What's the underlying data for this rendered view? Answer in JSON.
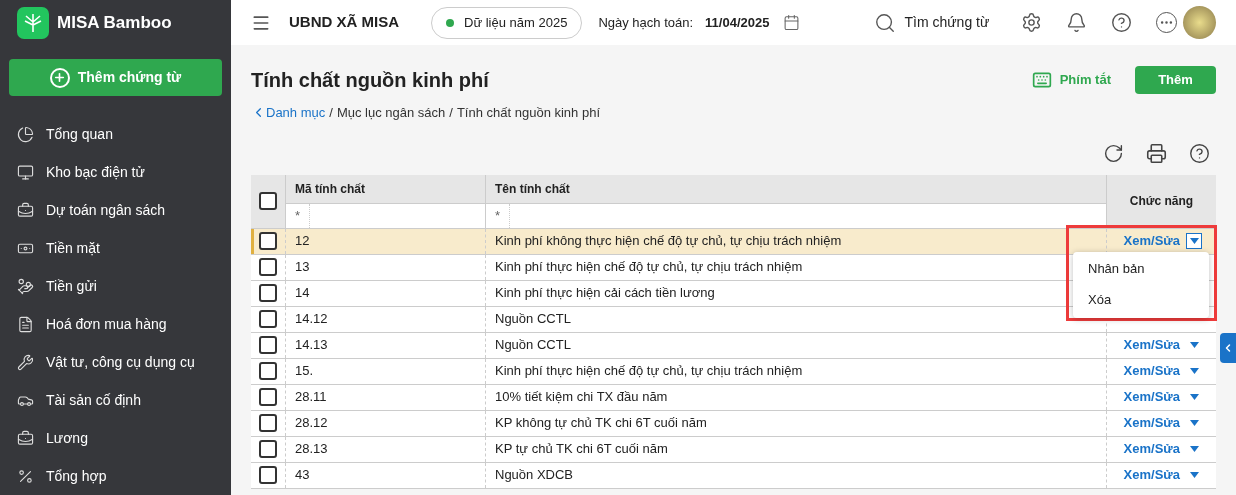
{
  "app": {
    "name": "MISA Bamboo",
    "add_voucher": "Thêm chứng từ"
  },
  "sidebar": {
    "items": [
      {
        "label": "Tổng quan"
      },
      {
        "label": "Kho bạc điện tử"
      },
      {
        "label": "Dự toán ngân sách"
      },
      {
        "label": "Tiền mặt"
      },
      {
        "label": "Tiền gửi"
      },
      {
        "label": "Hoá đơn mua hàng"
      },
      {
        "label": "Vật tư, công cụ dụng cụ"
      },
      {
        "label": "Tài sản cố định"
      },
      {
        "label": "Lương"
      },
      {
        "label": "Tổng hợp"
      }
    ]
  },
  "header": {
    "org": "UBND XÃ MISA",
    "data_year": "Dữ liệu năm 2025",
    "posting_date_label": "Ngày hạch toán:",
    "posting_date": "11/04/2025",
    "search": "Tìm chứng từ"
  },
  "page": {
    "title": "Tính chất nguồn kinh phí",
    "breadcrumb_separator": "/",
    "breadcrumb": [
      {
        "label": "Danh mục",
        "link": true
      },
      {
        "label": "Mục lục ngân sách",
        "link": false
      },
      {
        "label": "Tính chất nguồn kinh phí",
        "link": false
      }
    ],
    "shortcuts": "Phím tắt",
    "add": "Thêm"
  },
  "table": {
    "all_checked": false,
    "columns": [
      "Mã tính chất",
      "Tên tính chất",
      "Chức năng"
    ],
    "filters": [
      "*",
      "*"
    ],
    "rows": [
      {
        "code": "12",
        "name": "Kinh phí không thực hiện chế độ tự chủ, tự chịu trách nhiệm",
        "action": "Xem/Sửa",
        "selected": true,
        "checked": false,
        "menu_open": true
      },
      {
        "code": "13",
        "name": "Kinh phí thực hiện chế độ tự chủ, tự chịu trách nhiệm",
        "selected": false,
        "checked": false
      },
      {
        "code": "14",
        "name": "Kinh phí thực hiện cải cách tiền lương",
        "selected": false,
        "checked": false
      },
      {
        "code": "14.12",
        "name": "Nguồn CCTL",
        "selected": false,
        "checked": false
      },
      {
        "code": "14.13",
        "name": "Nguồn CCTL",
        "action": "Xem/Sửa",
        "selected": false,
        "checked": false,
        "menu_open": false
      },
      {
        "code": "15.",
        "name": "Kinh phí thực hiện chế độ tự chủ, tự chịu trách nhiệm",
        "action": "Xem/Sửa",
        "selected": false,
        "checked": false,
        "menu_open": false
      },
      {
        "code": "28.11",
        "name": "10% tiết kiệm chi TX đầu năm",
        "action": "Xem/Sửa",
        "selected": false,
        "checked": false,
        "menu_open": false
      },
      {
        "code": "28.12",
        "name": "KP không tự chủ TK chi 6T cuối năm",
        "action": "Xem/Sửa",
        "selected": false,
        "checked": false,
        "menu_open": false
      },
      {
        "code": "28.13",
        "name": "KP tự chủ TK chi 6T cuối năm",
        "action": "Xem/Sửa",
        "selected": false,
        "checked": false,
        "menu_open": false
      },
      {
        "code": "43",
        "name": "Nguồn XDCB",
        "action": "Xem/Sửa",
        "selected": false,
        "checked": false,
        "menu_open": false
      }
    ],
    "action_menu": [
      "Nhân bản",
      "Xóa"
    ]
  }
}
